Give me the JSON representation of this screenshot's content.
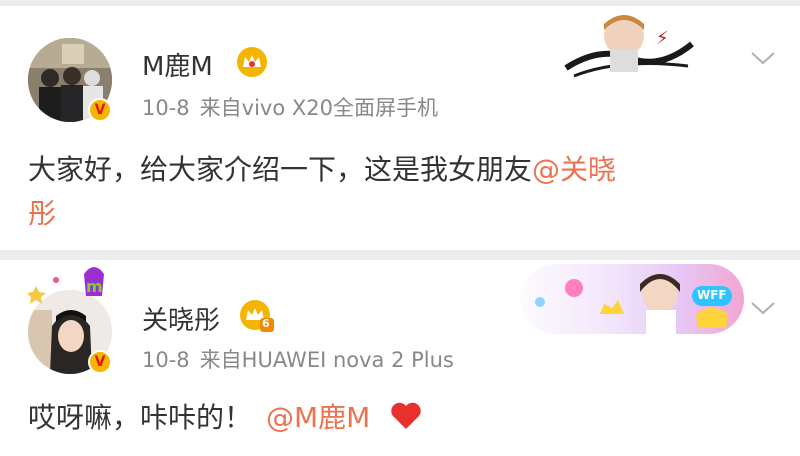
{
  "posts": [
    {
      "user": "M鹿M",
      "date": "10-8",
      "source_prefix": "来自",
      "source": "vivo X20全面屏手机",
      "text_line1": "大家好，给大家介绍一下，这是我女朋友",
      "mention_part1": "@关晓",
      "text_line2": "彤",
      "badge_letter": "V"
    },
    {
      "user": "关晓彤",
      "date": "10-8",
      "source_prefix": "来自",
      "source": "HUAWEI nova 2 Plus",
      "text": "哎呀嘛，咔咔的！",
      "mention": "@M鹿M",
      "badge_letter": "V",
      "crown_level": "6",
      "banner_label": "WFF"
    }
  ],
  "colors": {
    "mention": "#eb7350",
    "crown": "#f5b400",
    "heart": "#e8302f",
    "verified": "#f8b500"
  },
  "icons": [
    "crown-icon",
    "heart-icon",
    "chevron-down-icon",
    "verified-badge-icon"
  ]
}
